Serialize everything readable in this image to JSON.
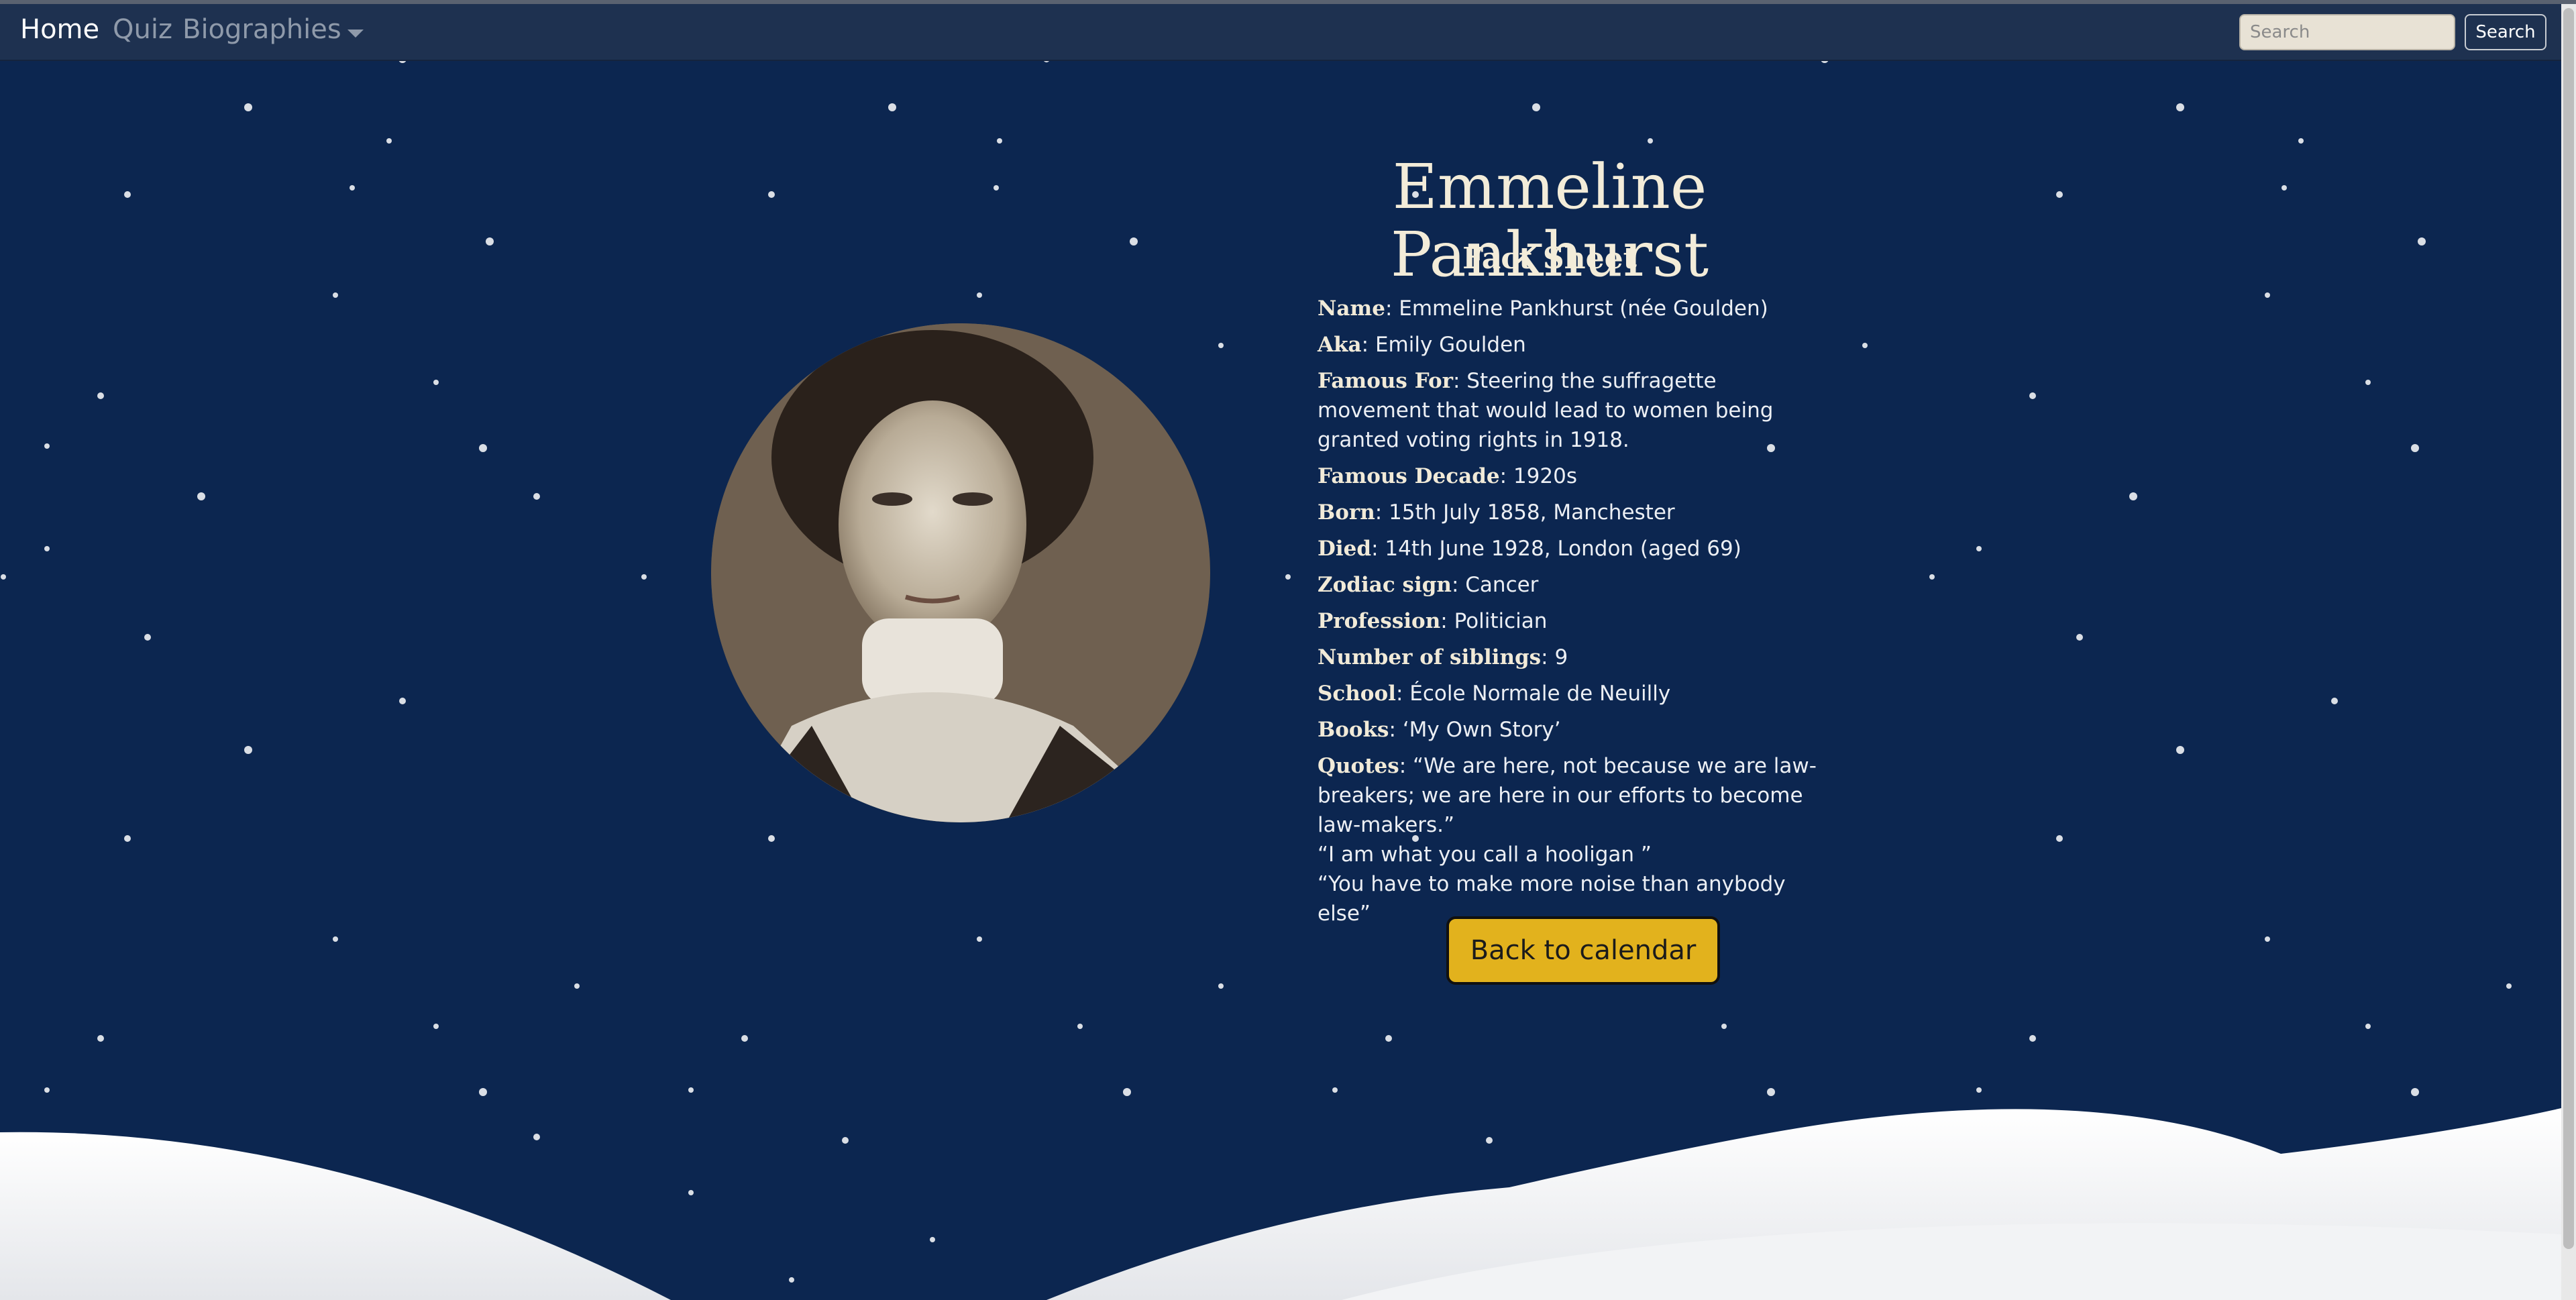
{
  "nav": {
    "home": "Home",
    "quiz": "Quiz",
    "biographies": "Biographies",
    "search_placeholder": "Search",
    "search_button": "Search"
  },
  "profile": {
    "title": "Emmeline Pankhurst",
    "subtitle": "Fact Sheet",
    "facts": [
      {
        "label": "Name",
        "value": "Emmeline Pankhurst (née Goulden)"
      },
      {
        "label": "Aka",
        "value": "Emily Goulden"
      },
      {
        "label": "Famous For",
        "value": "Steering the suffragette movement that would lead to women being granted voting rights in 1918."
      },
      {
        "label": "Famous Decade",
        "value": "1920s"
      },
      {
        "label": "Born",
        "value": "15th July 1858, Manchester"
      },
      {
        "label": "Died",
        "value": "14th June 1928, London (aged 69)"
      },
      {
        "label": "Zodiac sign",
        "value": "Cancer"
      },
      {
        "label": "Profession",
        "value": "Politician"
      },
      {
        "label": "Number of siblings",
        "value": "9"
      },
      {
        "label": "School",
        "value": "École Normale de Neuilly"
      },
      {
        "label": "Books",
        "value": "‘My Own Story’"
      }
    ],
    "quotes_label": "Quotes",
    "quotes": [
      "“We are here, not because we are law-breakers; we are here in our efforts to become law-makers.”",
      "“I am what you call a hooligan ”",
      "“You have to make more noise than anybody else”"
    ]
  },
  "back_button": "Back to calendar",
  "colors": {
    "background": "#0c2650",
    "navbar": "#1e3150",
    "accent_button": "#e2b21d",
    "title_text": "#f3ecd9"
  }
}
